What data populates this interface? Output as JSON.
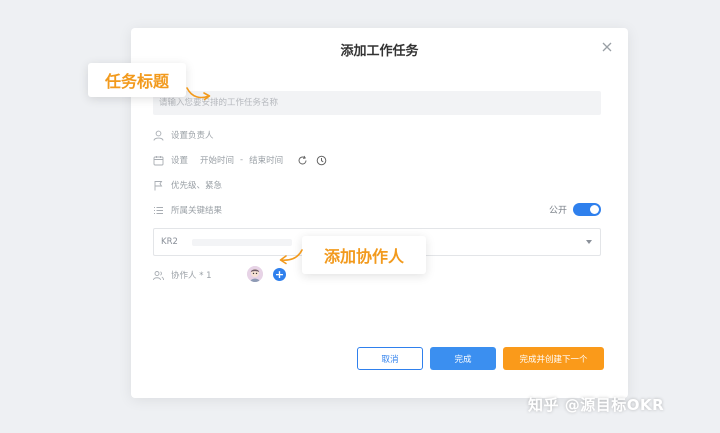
{
  "dialog": {
    "title": "添加工作任务",
    "task_placeholder": "请输入您要安排的工作任务名称",
    "assignee_label": "设置负责人",
    "time": {
      "set_label": "设置",
      "start_label": "开始时间",
      "separator": "-",
      "end_label": "结束时间"
    },
    "priority_label": "优先级、紧急",
    "key_result": {
      "label": "所属关键结果",
      "public_label": "公开",
      "public_on": true,
      "selected_value": "KR2"
    },
    "collaborators_label": "协作人 * 1",
    "buttons": {
      "cancel": "取消",
      "done": "完成",
      "done_and_next": "完成并创建下一个"
    }
  },
  "callouts": {
    "task_title": "任务标题",
    "add_collaborator": "添加协作人"
  },
  "add_icon_glyph": "+",
  "watermark": "知乎 @源目标OKR",
  "colors": {
    "primary_blue": "#2f80ed",
    "accent_orange": "#fa9a1a",
    "callout_text": "#f29a1d"
  }
}
